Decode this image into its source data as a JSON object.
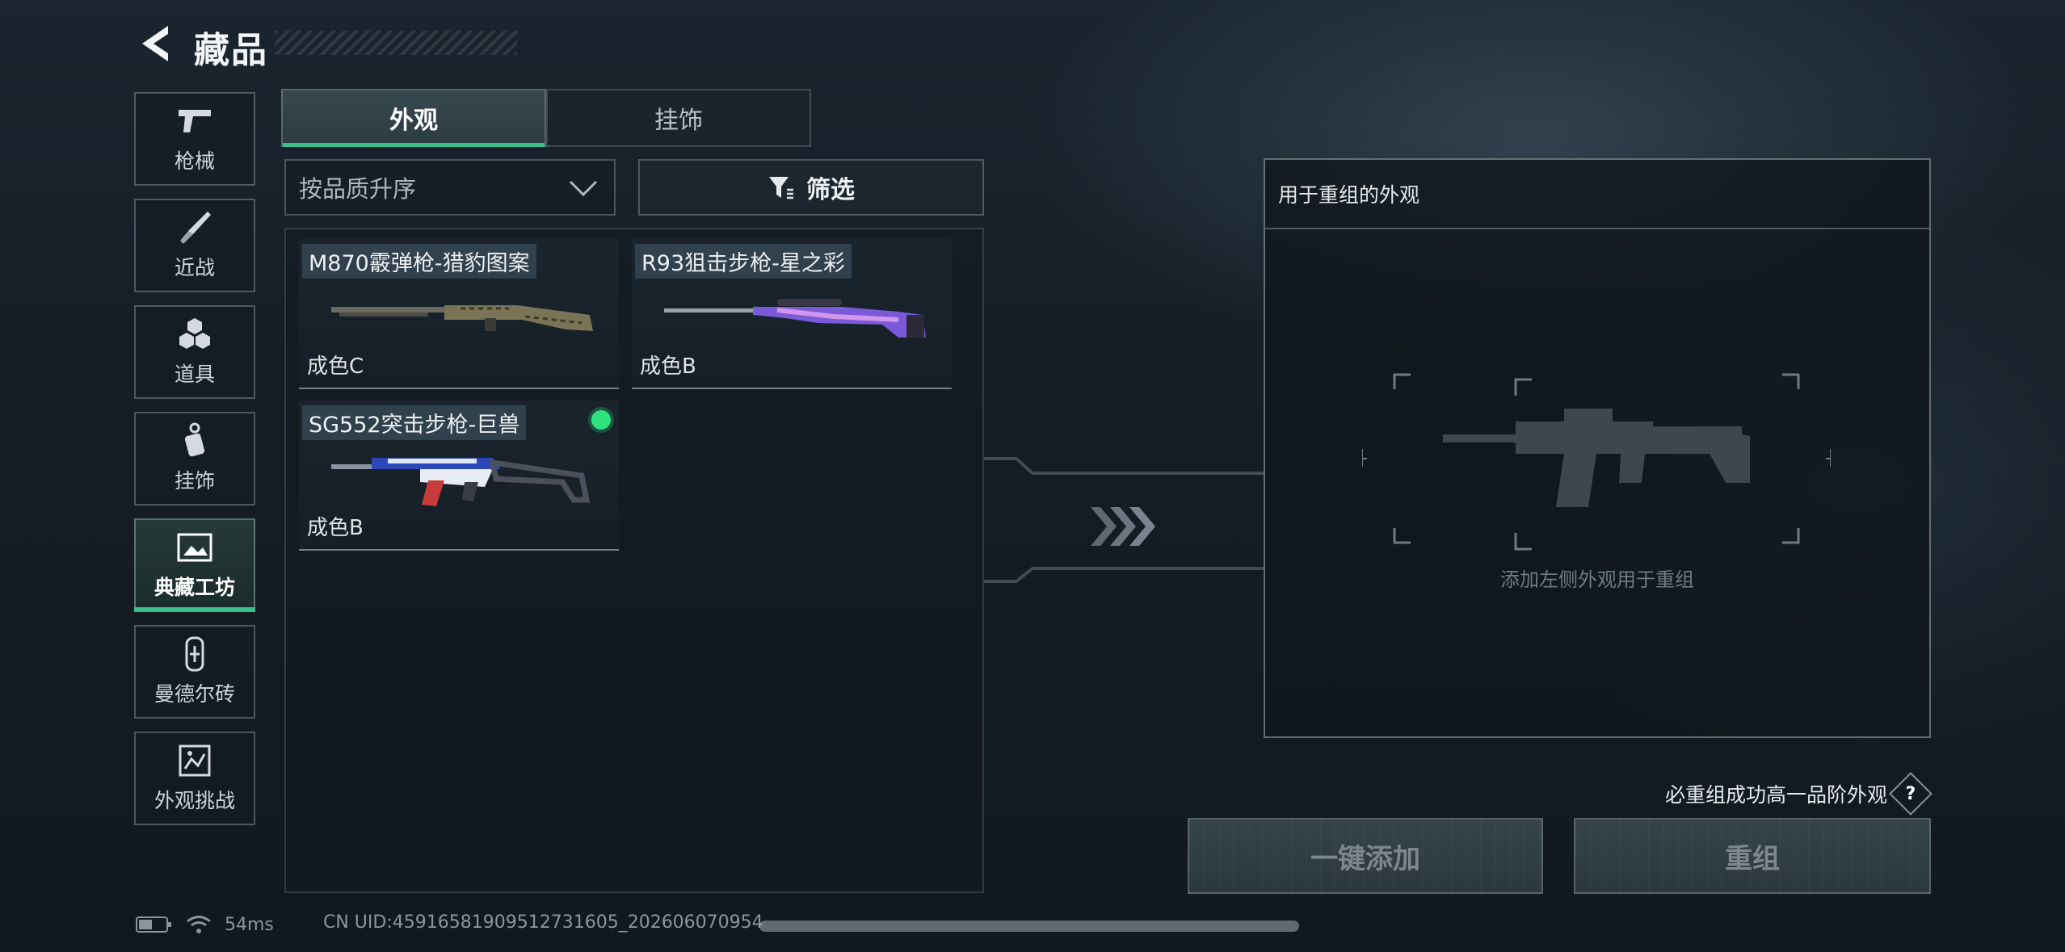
{
  "header": {
    "title": "藏品"
  },
  "sidebar": {
    "items": [
      {
        "label": "枪械",
        "icon": "pistol-icon"
      },
      {
        "label": "近战",
        "icon": "knife-icon"
      },
      {
        "label": "道具",
        "icon": "grenade-icon"
      },
      {
        "label": "挂饰",
        "icon": "charm-icon"
      },
      {
        "label": "典藏工坊",
        "icon": "gallery-icon",
        "active": true
      },
      {
        "label": "曼德尔砖",
        "icon": "brick-icon"
      },
      {
        "label": "外观挑战",
        "icon": "challenge-icon"
      }
    ]
  },
  "tabs": [
    {
      "label": "外观",
      "active": true
    },
    {
      "label": "挂饰",
      "active": false
    }
  ],
  "controls": {
    "sort_value": "按品质升序",
    "filter_label": "筛选"
  },
  "items": [
    {
      "name": "M870霰弹枪-猎豹图案",
      "grade": "成色C",
      "selected": false
    },
    {
      "name": "R93狙击步枪-星之彩",
      "grade": "成色B",
      "selected": false
    },
    {
      "name": "SG552突击步枪-巨兽",
      "grade": "成色B",
      "selected": true
    }
  ],
  "recombine": {
    "title": "用于重组的外观",
    "hint": "添加左侧外观用于重组"
  },
  "note": "必重组成功高一品阶外观",
  "buttons": {
    "add_all": "一键添加",
    "recombine": "重组"
  },
  "status": {
    "ping": "54ms",
    "uid": "CN UID:4591658190951273160​5_2026060709​54"
  },
  "colors": {
    "accent": "#39c08a",
    "selected_dot": "#2ee37e"
  }
}
